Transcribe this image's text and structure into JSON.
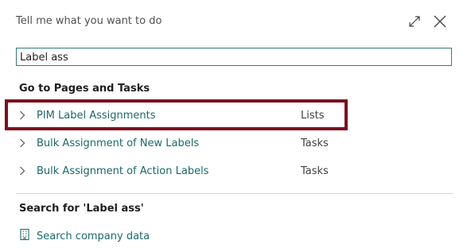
{
  "dialog": {
    "title": "Tell me what you want to do",
    "expand_icon": "expand-diagonal-icon",
    "close_icon": "close-icon"
  },
  "search": {
    "value": "Label ass",
    "border_color": "#2e7d7b"
  },
  "pages_section": {
    "heading": "Go to Pages and Tasks",
    "items": [
      {
        "label": "PIM Label Assignments",
        "category": "Lists",
        "icon": "chevron-right-icon",
        "highlighted": true
      },
      {
        "label": "Bulk Assignment of New Labels",
        "category": "Tasks",
        "icon": "chevron-right-icon"
      },
      {
        "label": "Bulk Assignment of Action Labels",
        "category": "Tasks",
        "icon": "chevron-right-icon"
      }
    ]
  },
  "search_section": {
    "heading": "Search for 'Label ass'",
    "company_data": {
      "label": "Search company data",
      "icon": "building-icon"
    }
  },
  "colors": {
    "link": "#1a6968",
    "highlight_border": "#7b0e1e"
  }
}
